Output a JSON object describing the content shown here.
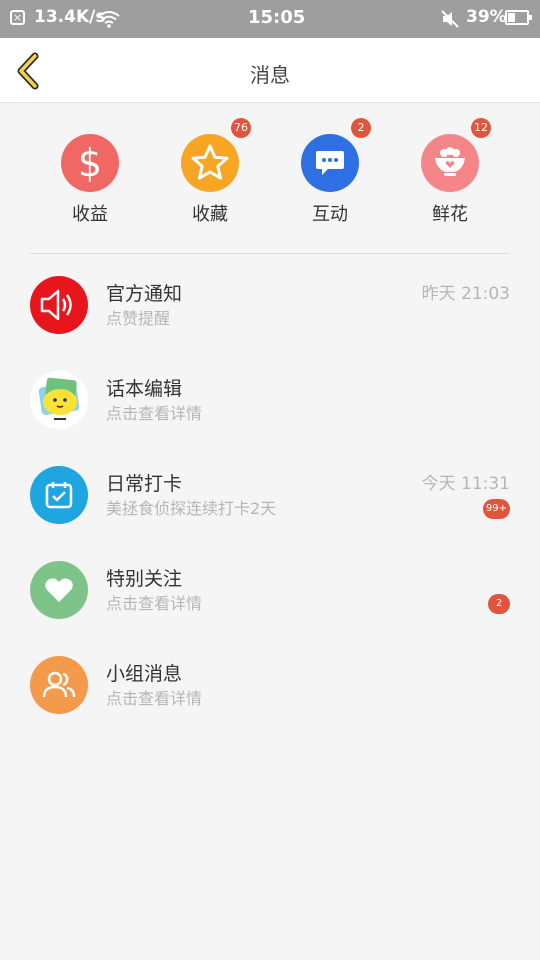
{
  "status_bar": {
    "close_glyph": "×",
    "net_speed": "13.4K/s",
    "time": "15:05",
    "battery": "39%",
    "battery_level": 0.39
  },
  "nav": {
    "title": "消息",
    "back_icon": "chevron-left-icon"
  },
  "quick_actions": [
    {
      "label": "收益",
      "icon": "dollar-icon",
      "color": "#f16763",
      "badge": ""
    },
    {
      "label": "收藏",
      "icon": "star-icon",
      "color": "#f6a623",
      "badge": "76"
    },
    {
      "label": "互动",
      "icon": "chat-bubble-icon",
      "color": "#2f6fe4",
      "badge": "2"
    },
    {
      "label": "鲜花",
      "icon": "flower-bowl-icon",
      "color": "#f4868a",
      "badge": "12"
    }
  ],
  "messages": [
    {
      "title": "官方通知",
      "subtitle": "点赞提醒",
      "time": "昨天 21:03",
      "badge": "",
      "icon": "speaker-icon",
      "color": "#e8161c"
    },
    {
      "title": "话本编辑",
      "subtitle": "点击查看详情",
      "time": "",
      "badge": "",
      "icon": "emoji-avatar-icon",
      "color": "#ffffff"
    },
    {
      "title": "日常打卡",
      "subtitle": "美拯食侦探连续打卡2天",
      "time": "今天 11:31",
      "badge": "99+",
      "icon": "calendar-check-icon",
      "color": "#1ea6e0"
    },
    {
      "title": "特别关注",
      "subtitle": "点击查看详情",
      "time": "",
      "badge": "2",
      "icon": "heart-icon",
      "color": "#7ec489"
    },
    {
      "title": "小组消息",
      "subtitle": "点击查看详情",
      "time": "",
      "badge": "",
      "icon": "group-icon",
      "color": "#f5994a"
    }
  ]
}
